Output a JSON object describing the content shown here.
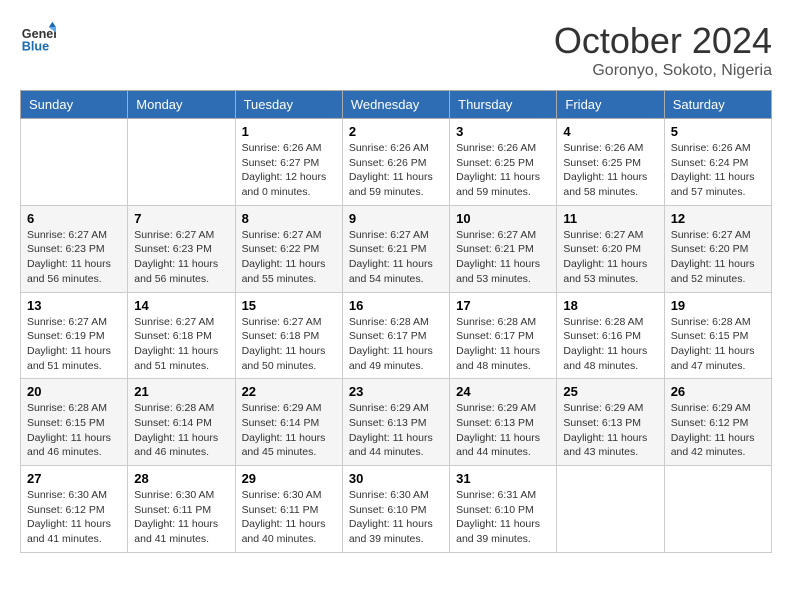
{
  "logo": {
    "text_general": "General",
    "text_blue": "Blue"
  },
  "header": {
    "month": "October 2024",
    "location": "Goronyo, Sokoto, Nigeria"
  },
  "weekdays": [
    "Sunday",
    "Monday",
    "Tuesday",
    "Wednesday",
    "Thursday",
    "Friday",
    "Saturday"
  ],
  "weeks": [
    [
      {
        "day": "",
        "sunrise": "",
        "sunset": "",
        "daylight": ""
      },
      {
        "day": "",
        "sunrise": "",
        "sunset": "",
        "daylight": ""
      },
      {
        "day": "1",
        "sunrise": "Sunrise: 6:26 AM",
        "sunset": "Sunset: 6:27 PM",
        "daylight": "Daylight: 12 hours and 0 minutes."
      },
      {
        "day": "2",
        "sunrise": "Sunrise: 6:26 AM",
        "sunset": "Sunset: 6:26 PM",
        "daylight": "Daylight: 11 hours and 59 minutes."
      },
      {
        "day": "3",
        "sunrise": "Sunrise: 6:26 AM",
        "sunset": "Sunset: 6:25 PM",
        "daylight": "Daylight: 11 hours and 59 minutes."
      },
      {
        "day": "4",
        "sunrise": "Sunrise: 6:26 AM",
        "sunset": "Sunset: 6:25 PM",
        "daylight": "Daylight: 11 hours and 58 minutes."
      },
      {
        "day": "5",
        "sunrise": "Sunrise: 6:26 AM",
        "sunset": "Sunset: 6:24 PM",
        "daylight": "Daylight: 11 hours and 57 minutes."
      }
    ],
    [
      {
        "day": "6",
        "sunrise": "Sunrise: 6:27 AM",
        "sunset": "Sunset: 6:23 PM",
        "daylight": "Daylight: 11 hours and 56 minutes."
      },
      {
        "day": "7",
        "sunrise": "Sunrise: 6:27 AM",
        "sunset": "Sunset: 6:23 PM",
        "daylight": "Daylight: 11 hours and 56 minutes."
      },
      {
        "day": "8",
        "sunrise": "Sunrise: 6:27 AM",
        "sunset": "Sunset: 6:22 PM",
        "daylight": "Daylight: 11 hours and 55 minutes."
      },
      {
        "day": "9",
        "sunrise": "Sunrise: 6:27 AM",
        "sunset": "Sunset: 6:21 PM",
        "daylight": "Daylight: 11 hours and 54 minutes."
      },
      {
        "day": "10",
        "sunrise": "Sunrise: 6:27 AM",
        "sunset": "Sunset: 6:21 PM",
        "daylight": "Daylight: 11 hours and 53 minutes."
      },
      {
        "day": "11",
        "sunrise": "Sunrise: 6:27 AM",
        "sunset": "Sunset: 6:20 PM",
        "daylight": "Daylight: 11 hours and 53 minutes."
      },
      {
        "day": "12",
        "sunrise": "Sunrise: 6:27 AM",
        "sunset": "Sunset: 6:20 PM",
        "daylight": "Daylight: 11 hours and 52 minutes."
      }
    ],
    [
      {
        "day": "13",
        "sunrise": "Sunrise: 6:27 AM",
        "sunset": "Sunset: 6:19 PM",
        "daylight": "Daylight: 11 hours and 51 minutes."
      },
      {
        "day": "14",
        "sunrise": "Sunrise: 6:27 AM",
        "sunset": "Sunset: 6:18 PM",
        "daylight": "Daylight: 11 hours and 51 minutes."
      },
      {
        "day": "15",
        "sunrise": "Sunrise: 6:27 AM",
        "sunset": "Sunset: 6:18 PM",
        "daylight": "Daylight: 11 hours and 50 minutes."
      },
      {
        "day": "16",
        "sunrise": "Sunrise: 6:28 AM",
        "sunset": "Sunset: 6:17 PM",
        "daylight": "Daylight: 11 hours and 49 minutes."
      },
      {
        "day": "17",
        "sunrise": "Sunrise: 6:28 AM",
        "sunset": "Sunset: 6:17 PM",
        "daylight": "Daylight: 11 hours and 48 minutes."
      },
      {
        "day": "18",
        "sunrise": "Sunrise: 6:28 AM",
        "sunset": "Sunset: 6:16 PM",
        "daylight": "Daylight: 11 hours and 48 minutes."
      },
      {
        "day": "19",
        "sunrise": "Sunrise: 6:28 AM",
        "sunset": "Sunset: 6:15 PM",
        "daylight": "Daylight: 11 hours and 47 minutes."
      }
    ],
    [
      {
        "day": "20",
        "sunrise": "Sunrise: 6:28 AM",
        "sunset": "Sunset: 6:15 PM",
        "daylight": "Daylight: 11 hours and 46 minutes."
      },
      {
        "day": "21",
        "sunrise": "Sunrise: 6:28 AM",
        "sunset": "Sunset: 6:14 PM",
        "daylight": "Daylight: 11 hours and 46 minutes."
      },
      {
        "day": "22",
        "sunrise": "Sunrise: 6:29 AM",
        "sunset": "Sunset: 6:14 PM",
        "daylight": "Daylight: 11 hours and 45 minutes."
      },
      {
        "day": "23",
        "sunrise": "Sunrise: 6:29 AM",
        "sunset": "Sunset: 6:13 PM",
        "daylight": "Daylight: 11 hours and 44 minutes."
      },
      {
        "day": "24",
        "sunrise": "Sunrise: 6:29 AM",
        "sunset": "Sunset: 6:13 PM",
        "daylight": "Daylight: 11 hours and 44 minutes."
      },
      {
        "day": "25",
        "sunrise": "Sunrise: 6:29 AM",
        "sunset": "Sunset: 6:13 PM",
        "daylight": "Daylight: 11 hours and 43 minutes."
      },
      {
        "day": "26",
        "sunrise": "Sunrise: 6:29 AM",
        "sunset": "Sunset: 6:12 PM",
        "daylight": "Daylight: 11 hours and 42 minutes."
      }
    ],
    [
      {
        "day": "27",
        "sunrise": "Sunrise: 6:30 AM",
        "sunset": "Sunset: 6:12 PM",
        "daylight": "Daylight: 11 hours and 41 minutes."
      },
      {
        "day": "28",
        "sunrise": "Sunrise: 6:30 AM",
        "sunset": "Sunset: 6:11 PM",
        "daylight": "Daylight: 11 hours and 41 minutes."
      },
      {
        "day": "29",
        "sunrise": "Sunrise: 6:30 AM",
        "sunset": "Sunset: 6:11 PM",
        "daylight": "Daylight: 11 hours and 40 minutes."
      },
      {
        "day": "30",
        "sunrise": "Sunrise: 6:30 AM",
        "sunset": "Sunset: 6:10 PM",
        "daylight": "Daylight: 11 hours and 39 minutes."
      },
      {
        "day": "31",
        "sunrise": "Sunrise: 6:31 AM",
        "sunset": "Sunset: 6:10 PM",
        "daylight": "Daylight: 11 hours and 39 minutes."
      },
      {
        "day": "",
        "sunrise": "",
        "sunset": "",
        "daylight": ""
      },
      {
        "day": "",
        "sunrise": "",
        "sunset": "",
        "daylight": ""
      }
    ]
  ]
}
